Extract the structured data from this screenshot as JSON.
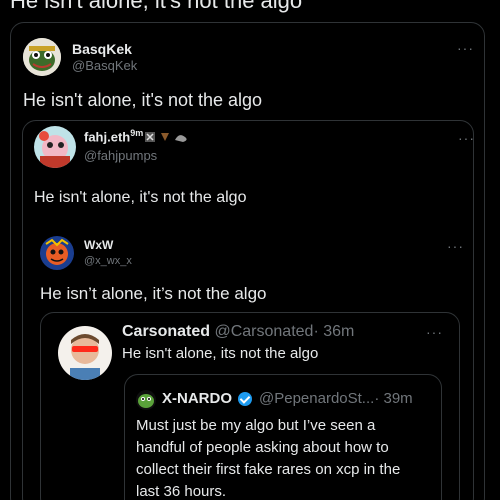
{
  "top": {
    "text": "He isn't alone, it's not the algo"
  },
  "tweet1": {
    "name": "BasqKek",
    "handle": "@BasqKek",
    "text": "He isn't alone, it's not the algo"
  },
  "tweet2": {
    "name": "fahj.eth",
    "name_suffix": "9m",
    "handle": "@fahjpumps",
    "text": "He isn't alone, it's not the algo"
  },
  "tweet3": {
    "name": "WxW",
    "handle": "@x_wx_x",
    "text": "He isn’t alone, it’s not the algo"
  },
  "tweet4": {
    "name": "Carsonated",
    "handle": "@Carsonated",
    "time": "· 36m",
    "text": "He isn't alone, its not the algo"
  },
  "tweet5": {
    "name": "X-NARDO",
    "handle": "@PepenardoSt...",
    "time": "· 39m",
    "lines": [
      "Must just be my algo but I’ve seen a",
      "handful of people asking about how to",
      "collect their first fake rares on xcp in the",
      "last 36 hours."
    ]
  },
  "more_icon": "···",
  "colors": {
    "background": "#000000",
    "border": "#2f3336",
    "text": "#e7e9ea",
    "muted": "#71767b",
    "verified": "#1d9bf0"
  }
}
